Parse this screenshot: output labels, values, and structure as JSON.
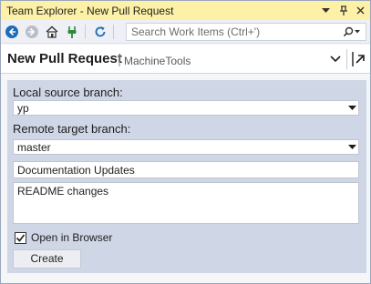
{
  "window": {
    "title": "Team Explorer - New Pull Request",
    "buttons": {
      "dropdown": "▾",
      "pin": "ᚠ",
      "close": "✕"
    }
  },
  "toolbar": {
    "icons": [
      "back-arrow-icon",
      "forward-arrow-icon",
      "home-icon",
      "connect-plug-icon",
      "refresh-icon"
    ],
    "search_placeholder": "Search Work Items (Ctrl+')"
  },
  "header": {
    "title": "New Pull Request",
    "separator": "|",
    "context": "MachineTools"
  },
  "form": {
    "source_label": "Local source branch:",
    "source_value": "yp",
    "target_label": "Remote target branch:",
    "target_value": "master",
    "pr_title": "Documentation Updates",
    "pr_description": "README changes",
    "open_in_browser_label": "Open in Browser",
    "open_in_browser_checked": true,
    "create_label": "Create"
  },
  "colors": {
    "titlebar": "#fdf1a8",
    "panel": "#cfd6e5",
    "toolbar": "#eef0f5",
    "accent_blue": "#1e6bb8"
  }
}
